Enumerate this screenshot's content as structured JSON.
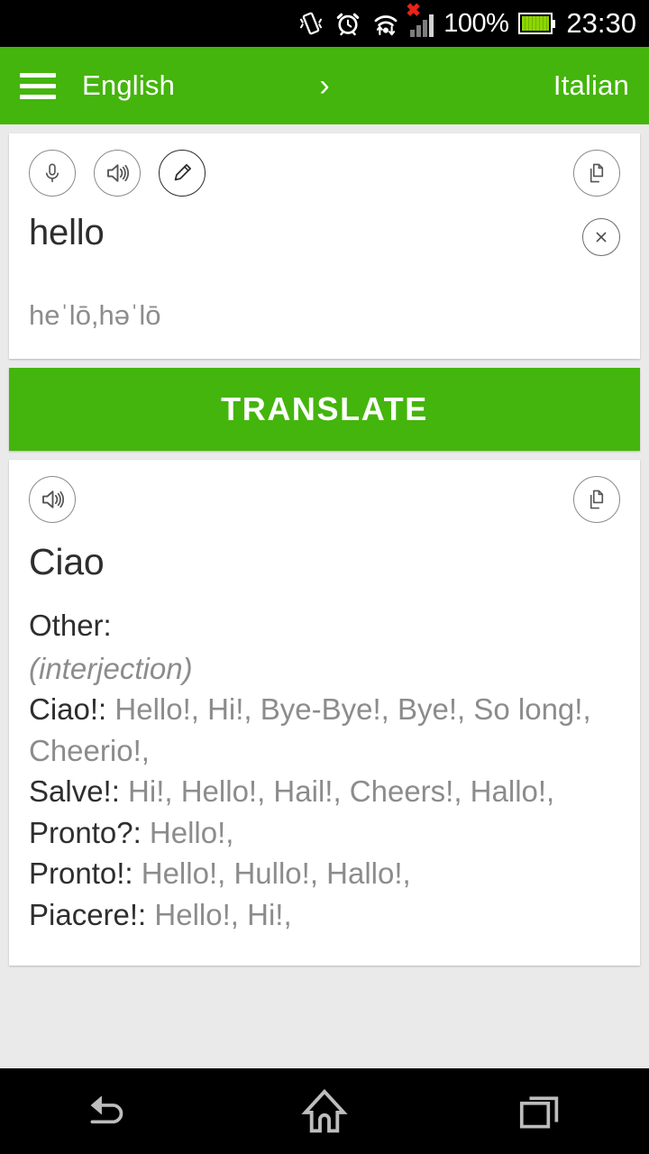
{
  "statusbar": {
    "icons": [
      "vibrate-icon",
      "alarm-clock-icon",
      "wifi-transfer-icon",
      "signal-bars-icon"
    ],
    "signal_error": "✖",
    "battery_percent": "100%",
    "battery_icon": "battery-full-icon",
    "clock": "23:30"
  },
  "appbar": {
    "menu_icon": "hamburger-menu-icon",
    "source_language": "English",
    "arrow_icon": "›",
    "target_language": "Italian"
  },
  "source_card": {
    "icons": [
      {
        "name": "microphone-icon",
        "label": "Speak"
      },
      {
        "name": "speaker-icon",
        "label": "Listen"
      },
      {
        "name": "pencil-icon",
        "label": "Handwrite"
      }
    ],
    "copy_icon": "copy-icon",
    "text": "hello",
    "clear_icon": "×",
    "phonetic": "heˈlō,həˈlō"
  },
  "translate_button": {
    "label": "TRANSLATE",
    "color": "#44b50c"
  },
  "result_card": {
    "speaker_icon": "speaker-icon",
    "copy_icon": "copy-icon",
    "translation": "Ciao",
    "section_label": "Other:",
    "part_of_speech": "(interjection)",
    "entries": [
      {
        "term": "Ciao!:",
        "meanings": " Hello!, Hi!, Bye-Bye!, Bye!, So long!, Cheerio!,"
      },
      {
        "term": "Salve!:",
        "meanings": " Hi!, Hello!, Hail!, Cheers!, Hallo!,"
      },
      {
        "term": "Pronto?:",
        "meanings": " Hello!,"
      },
      {
        "term": "Pronto!:",
        "meanings": " Hello!, Hullo!, Hallo!,"
      },
      {
        "term": "Piacere!:",
        "meanings": " Hello!, Hi!,"
      }
    ]
  },
  "navbar": {
    "buttons": [
      {
        "name": "back-button",
        "icon": "back-arrow-icon"
      },
      {
        "name": "home-button",
        "icon": "home-icon"
      },
      {
        "name": "recents-button",
        "icon": "recent-apps-icon"
      }
    ]
  },
  "colors": {
    "brand_green": "#44b50c",
    "page_background": "#eaeaea",
    "card_background": "#ffffff",
    "primary_text": "#2e2e2e",
    "secondary_text": "#8c8c8c",
    "status_error": "#e8231b"
  }
}
